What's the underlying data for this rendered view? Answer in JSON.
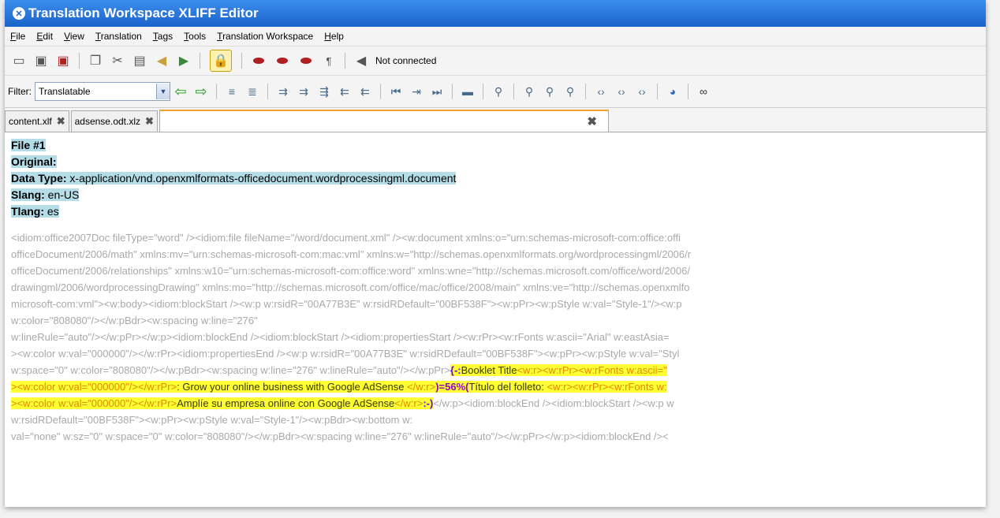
{
  "window": {
    "title": "Translation Workspace XLIFF Editor"
  },
  "menu": [
    "File",
    "Edit",
    "View",
    "Translation",
    "Tags",
    "Tools",
    "Translation Workspace",
    "Help"
  ],
  "toolbar": {
    "status": "Not connected"
  },
  "filter": {
    "label": "Filter:",
    "value": "Translatable"
  },
  "tabs": [
    {
      "label": "content.xlf"
    },
    {
      "label": "adsense.odt.xlz"
    }
  ],
  "file_header": {
    "file_label": "File #1",
    "original_label": "Original:",
    "datatype_label": "Data Type:",
    "datatype_value": " x-application/vnd.openxmlformats-officedocument.wordprocessingml.document",
    "slang_label": "Slang:",
    "slang_value": " en-US",
    "tlang_label": "Tlang:",
    "tlang_value": " es"
  },
  "markup_lines": [
    "<idiom:office2007Doc fileType=\"word\" /><idiom:file fileName=\"/word/document.xml\" /><w:document xmlns:o=\"urn:schemas-microsoft-com:office:offi",
    "officeDocument/2006/math\" xmlns:mv=\"urn:schemas-microsoft-com:mac:vml\" xmlns:w=\"http://schemas.openxmlformats.org/wordprocessingml/2006/r",
    "officeDocument/2006/relationships\" xmlns:w10=\"urn:schemas-microsoft-com:office:word\" xmlns:wne=\"http://schemas.microsoft.com/office/word/2006/",
    "drawingml/2006/wordprocessingDrawing\" xmlns:mo=\"http://schemas.microsoft.com/office/mac/office/2008/main\" xmlns:ve=\"http://schemas.openxmlfo",
    "microsoft-com:vml\"><w:body><idiom:blockStart /><w:p w:rsidR=\"00A77B3E\" w:rsidRDefault=\"00BF538F\"><w:pPr><w:pStyle w:val=\"Style-1\"/><w:p",
    "w:color=\"808080\"/></w:pBdr><w:spacing w:line=\"276\"",
    "w:lineRule=\"auto\"/></w:pPr></w:p><idiom:blockEnd /><idiom:blockStart /><idiom:propertiesStart /><w:rPr><w:rFonts w:ascii=\"Arial\" w:eastAsia=",
    "><w:color w:val=\"000000\"/></w:rPr><idiom:propertiesEnd /><w:p w:rsidR=\"00A77B3E\" w:rsidRDefault=\"00BF538F\"><w:pPr><w:pStyle w:val=\"Styl"
  ],
  "segment": {
    "pre": "w:space=\"0\" w:color=\"808080\"/></w:pBdr><w:spacing w:line=\"276\" w:lineRule=\"auto\"/></w:pPr>",
    "open_mark": "{-:",
    "src1": "Booklet Title",
    "tag1": "<w:r><w:rPr><w:rFonts w:ascii=\"",
    "tag2": "><w:color w:val=\"000000\"/></w:rPr>",
    "src2": ": Grow your online business with Google AdSense ",
    "tag3": "</w:r>",
    "pct": ")=56%(",
    "tgt1": "Título del folleto: ",
    "tag4": "<w:r><w:rPr><w:rFonts w:",
    "tag5": "><w:color w:val=\"000000\"/></w:rPr>",
    "tgt2": "Amplíe su empresa online con Google AdSense",
    "tag6": "</w:r>",
    "close_mark": ":-)",
    "post": "</w:p><idiom:blockEnd /><idiom:blockStart /><w:p w"
  },
  "markup_tail": [
    "w:rsidRDefault=\"00BF538F\"><w:pPr><w:pStyle w:val=\"Style-1\"/><w:pBdr><w:bottom w:",
    "val=\"none\" w:sz=\"0\" w:space=\"0\" w:color=\"808080\"/></w:pBdr><w:spacing w:line=\"276\" w:lineRule=\"auto\"/></w:pPr></w:p><idiom:blockEnd /><"
  ]
}
